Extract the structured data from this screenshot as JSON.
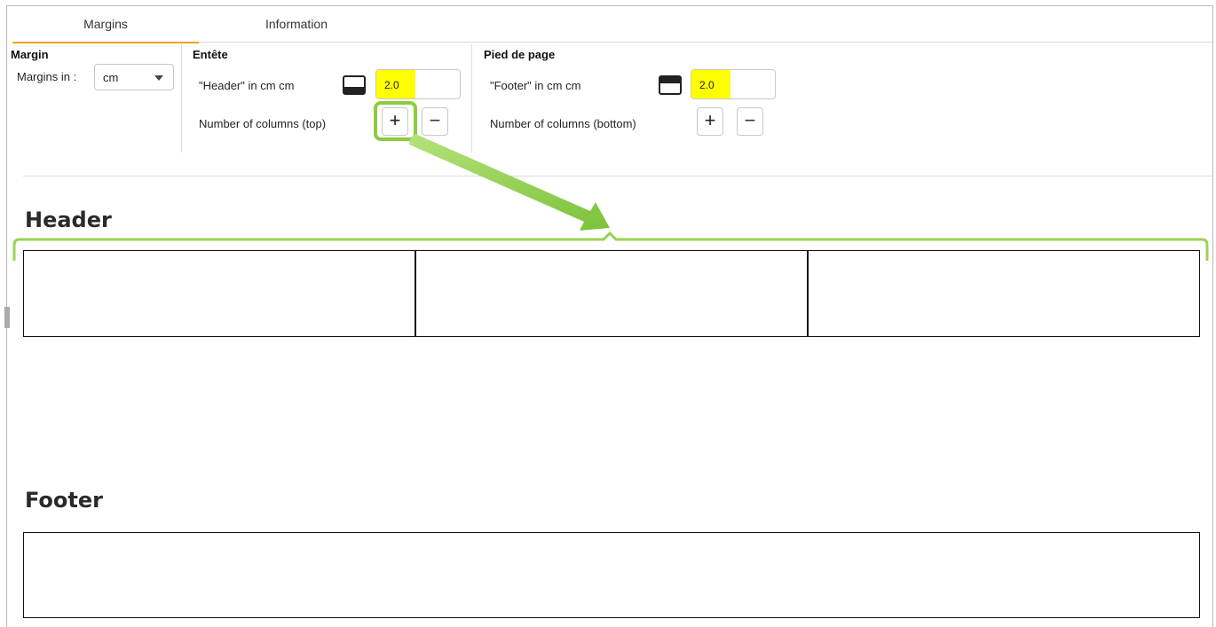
{
  "tabs": [
    {
      "label": "Margins",
      "active": true
    },
    {
      "label": "Information",
      "active": false
    }
  ],
  "margin_group": {
    "title": "Margin",
    "margins_in_label": "Margins in :",
    "unit_selected": "cm"
  },
  "header_group": {
    "title": "Entête",
    "height_label": "\"Header\" in cm  cm",
    "height_value": "2.0",
    "columns_label": "Number of columns (top)",
    "add_symbol": "+",
    "remove_symbol": "−"
  },
  "footer_group": {
    "title": "Pied de page",
    "height_label": "\"Footer\" in cm  cm",
    "height_value": "2.0",
    "columns_label": "Number of columns (bottom)",
    "add_symbol": "+",
    "remove_symbol": "−"
  },
  "preview": {
    "header_title": "Header",
    "header_columns": 3,
    "footer_title": "Footer",
    "footer_columns": 1
  },
  "colors": {
    "active_tab": "#f0a323",
    "highlight": "#ffff00",
    "annotation": "#8ccc3f"
  }
}
